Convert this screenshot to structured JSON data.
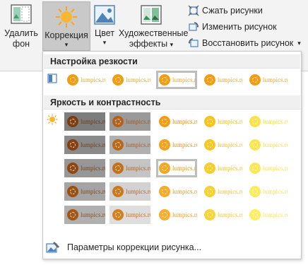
{
  "ribbon": {
    "remove_bg": {
      "line1": "Удалить",
      "line2": "фон"
    },
    "correction": {
      "label": "Коррекция",
      "arrow": "▾"
    },
    "color": {
      "label": "Цвет",
      "arrow": "▾"
    },
    "artistic": {
      "line1": "Художественные",
      "line2": "эффекты",
      "arrow": "▾"
    },
    "compress": "Сжать рисунки",
    "change": "Изменить рисунок",
    "reset": "Восстановить рисунок",
    "reset_arrow": "▾"
  },
  "panel": {
    "sharpness_header": "Настройка резкости",
    "brightness_header": "Яркость и контрастность",
    "watermark": "lumpics.ru",
    "sharpness_selected_index": 2,
    "brightness_selected": [
      2,
      2
    ],
    "footer_label": "Параметры коррекции рисунка..."
  },
  "icons": {
    "remove_bg": "remove-background-icon",
    "correction": "sun-correction-icon",
    "color": "color-picture-icon",
    "artistic": "artistic-effects-icon",
    "compress": "compress-pictures-icon",
    "change": "change-picture-icon",
    "reset": "reset-picture-icon",
    "sharpness_row": "sharpness-icon",
    "brightness_row": "brightness-sun-icon",
    "footer": "picture-options-icon"
  },
  "colors": {
    "accent_orange": "#f5a623",
    "selection_border": "#bdbdbd",
    "active_button_bg": "#c9c9c9"
  }
}
